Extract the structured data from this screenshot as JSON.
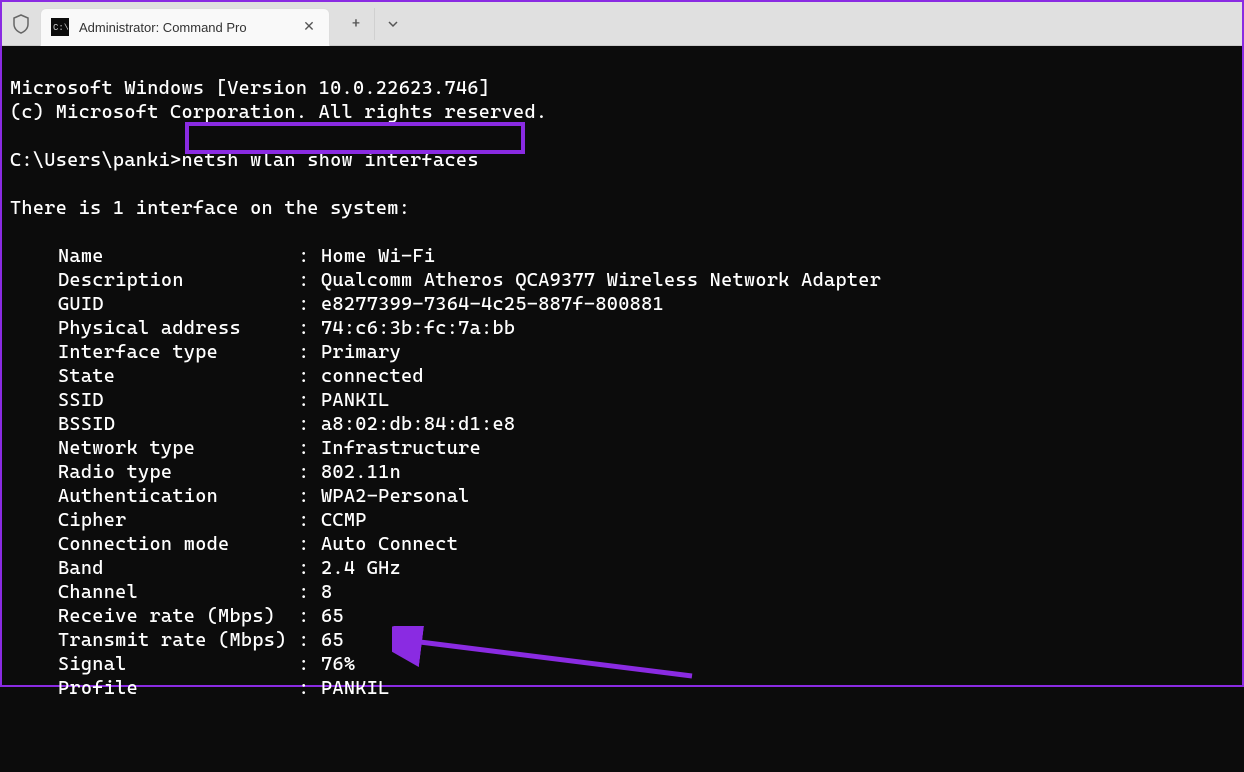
{
  "tab": {
    "title": "Administrator: Command Pro",
    "icon_label": "cmd"
  },
  "terminal": {
    "header_line1": "Microsoft Windows [Version 10.0.22623.746]",
    "header_line2": "(c) Microsoft Corporation. All rights reserved.",
    "prompt": "C:\\Users\\panki>",
    "command": "netsh wlan show interfaces",
    "interface_line": "There is 1 interface on the system:",
    "fields": [
      {
        "label": "Name",
        "value": "Home Wi-Fi"
      },
      {
        "label": "Description",
        "value": "Qualcomm Atheros QCA9377 Wireless Network Adapter"
      },
      {
        "label": "GUID",
        "value": "e8277399-7364-4c25-887f-800881"
      },
      {
        "label": "Physical address",
        "value": "74:c6:3b:fc:7a:bb"
      },
      {
        "label": "Interface type",
        "value": "Primary"
      },
      {
        "label": "State",
        "value": "connected"
      },
      {
        "label": "SSID",
        "value": "PANKIL"
      },
      {
        "label": "BSSID",
        "value": "a8:02:db:84:d1:e8"
      },
      {
        "label": "Network type",
        "value": "Infrastructure"
      },
      {
        "label": "Radio type",
        "value": "802.11n"
      },
      {
        "label": "Authentication",
        "value": "WPA2-Personal"
      },
      {
        "label": "Cipher",
        "value": "CCMP"
      },
      {
        "label": "Connection mode",
        "value": "Auto Connect"
      },
      {
        "label": "Band",
        "value": "2.4 GHz"
      },
      {
        "label": "Channel",
        "value": "8"
      },
      {
        "label": "Receive rate (Mbps)",
        "value": "65"
      },
      {
        "label": "Transmit rate (Mbps)",
        "value": "65"
      },
      {
        "label": "Signal",
        "value": "76%"
      },
      {
        "label": "Profile",
        "value": "PANKIL"
      }
    ]
  },
  "annotations": {
    "highlight_color": "#8a2be2"
  }
}
